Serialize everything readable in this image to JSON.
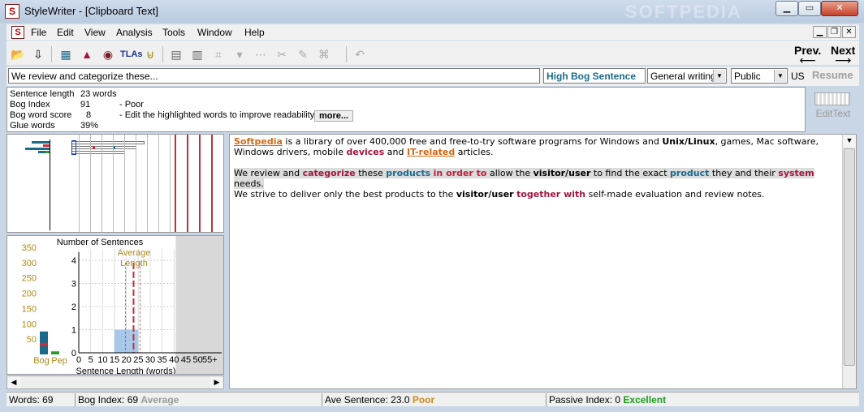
{
  "window": {
    "app_name": "StyleWriter",
    "title": "StyleWriter - [Clipboard Text]",
    "watermark": "SOFTPEDIA"
  },
  "menu": [
    "File",
    "Edit",
    "View",
    "Analysis",
    "Tools",
    "Window",
    "Help"
  ],
  "toolbar": {
    "prev_label": "Prev.",
    "next_label": "Next",
    "tlas_label": "TLAs"
  },
  "sentence_row": {
    "current_sentence": "We review and categorize these...",
    "status": "High Bog Sentence",
    "writing_type": "General writing",
    "audience": "Public",
    "language": "US",
    "resume_label": "Resume"
  },
  "stats": [
    {
      "label": "Sentence length",
      "value": "23 words",
      "note": ""
    },
    {
      "label": "Bog Index",
      "value": "91",
      "note": "- Poor"
    },
    {
      "label": "Bog word score",
      "value": "8",
      "note": "- Edit the highlighted words to improve readability."
    },
    {
      "label": "Glue words",
      "value": "39%",
      "note": ""
    }
  ],
  "more_label": "more...",
  "edit_text_label": "EditText",
  "chart_data": {
    "type": "bar",
    "title": "Number of Sentences",
    "xlabel": "Sentence Length (words)",
    "x_ticks": [
      "0",
      "5",
      "10",
      "15",
      "20",
      "25",
      "30",
      "35",
      "40",
      "45",
      "50",
      "55+"
    ],
    "y_ticks": [
      "0",
      "1",
      "2",
      "3",
      "4"
    ],
    "left_scale_ticks": [
      "50",
      "100",
      "150",
      "200",
      "250",
      "300",
      "350"
    ],
    "left_bars_label_1": "Bog",
    "left_bars_label_2": "Pep",
    "left_bars": [
      {
        "name": "Bog",
        "value": 75,
        "color": "#1a6a8a"
      },
      {
        "name": "Pep",
        "value": 10,
        "color": "#2a9a2a"
      }
    ],
    "histogram": [
      {
        "x_start": 15,
        "x_end": 25,
        "count": 1
      }
    ],
    "average_label_1": "Average",
    "average_label_2": "Length",
    "average_value": 23,
    "ylim": [
      0,
      4
    ],
    "xlim": [
      0,
      55
    ],
    "colors": {
      "average": "#c0303a",
      "bars": "#a8c8ea",
      "axis_labels": "#b08a1a"
    }
  },
  "text": {
    "para1": [
      {
        "t": "Softpedia",
        "c": "c-org"
      },
      {
        "t": " is a library of over 400,000 free and free-to-try software programs for Windows and ",
        "c": ""
      },
      {
        "t": "Unix/Linux",
        "c": "c-black"
      },
      {
        "t": ", games, Mac software, Windows drivers, mobile ",
        "c": ""
      },
      {
        "t": "devices",
        "c": "c-maroon"
      },
      {
        "t": " and ",
        "c": ""
      },
      {
        "t": "IT-related",
        "c": "c-org"
      },
      {
        "t": " articles.",
        "c": ""
      }
    ],
    "para2_highlight": [
      {
        "t": "We review and ",
        "c": ""
      },
      {
        "t": "categorize",
        "c": "c-maroon"
      },
      {
        "t": " these ",
        "c": ""
      },
      {
        "t": "products",
        "c": "c-blue"
      },
      {
        "t": " ",
        "c": ""
      },
      {
        "t": "in order to",
        "c": "c-red"
      },
      {
        "t": " allow the ",
        "c": ""
      },
      {
        "t": "visitor/user",
        "c": "c-black"
      },
      {
        "t": " to find the exact ",
        "c": ""
      },
      {
        "t": "product",
        "c": "c-blue"
      },
      {
        "t": " they and their ",
        "c": ""
      },
      {
        "t": "system",
        "c": "c-maroon"
      },
      {
        "t": " needs.",
        "c": ""
      }
    ],
    "para2_rest": [
      {
        "t": "We strive to deliver only the best products to the ",
        "c": ""
      },
      {
        "t": "visitor/user",
        "c": "c-black"
      },
      {
        "t": " ",
        "c": ""
      },
      {
        "t": "together with",
        "c": "c-maroon"
      },
      {
        "t": " self-made evaluation and review notes.",
        "c": ""
      }
    ]
  },
  "statusbar": {
    "words": "Words: 69",
    "bog_index": "Bog Index: 69",
    "bog_rating": "Average",
    "ave_sentence": "Ave Sentence: 23.0",
    "ave_rating": "Poor",
    "passive": "Passive Index: 0",
    "passive_rating": "Excellent"
  }
}
